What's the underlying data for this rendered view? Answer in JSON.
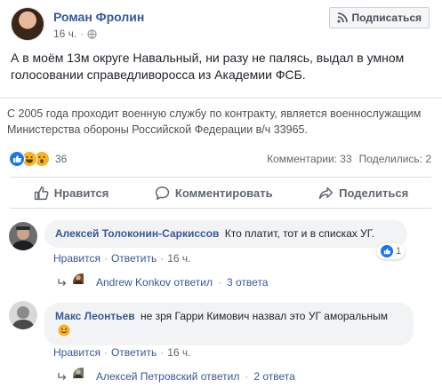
{
  "post": {
    "author": "Роман Фролин",
    "time": "16 ч.",
    "dot": "·",
    "subscribe_label": "Подписаться",
    "text": "А в моём 13м округе Навальный, ни разу не палясь, выдал в умном голосовании справедливоросса из Академии ФСБ.",
    "quote": "С 2005 года проходит военную службу по контракту, является военнослужащим Министерства обороны Российской Федерации в/ч 33965.",
    "reaction_count": "36",
    "comments_count": "Комментарии: 33",
    "shares_count": "Поделились: 2",
    "actions": {
      "like": "Нравится",
      "comment": "Комментировать",
      "share": "Поделиться"
    }
  },
  "comments": [
    {
      "author": "Алексей Толоконин-Саркиссов",
      "text": "Кто платит, тот и в списках УГ.",
      "like_link": "Нравится",
      "reply_link": "Ответить",
      "time": "16 ч.",
      "sep": "·",
      "likes": "1",
      "reply_author": "Andrew Konkov ответил",
      "reply_count": "3 ответа"
    },
    {
      "author": "Макс Леонтьев",
      "text": "не зря Гарри Кимович назвал это УГ аморальным",
      "like_link": "Нравится",
      "reply_link": "Ответить",
      "time": "16 ч.",
      "sep": "·",
      "reply_author": "Алексей Петровский ответил",
      "reply_count": "2 ответа"
    }
  ],
  "colors": {
    "link": "#385898",
    "like_blue": "#1877f2",
    "muted": "#616770",
    "bubble_bg": "#f2f3f5"
  },
  "icons": [
    "globe-icon",
    "rss-icon",
    "like-reaction-icon",
    "haha-reaction-icon",
    "wow-reaction-icon",
    "thumbs-up-icon",
    "comment-icon",
    "share-icon",
    "reply-arrow-icon",
    "emoji-smile-icon"
  ]
}
